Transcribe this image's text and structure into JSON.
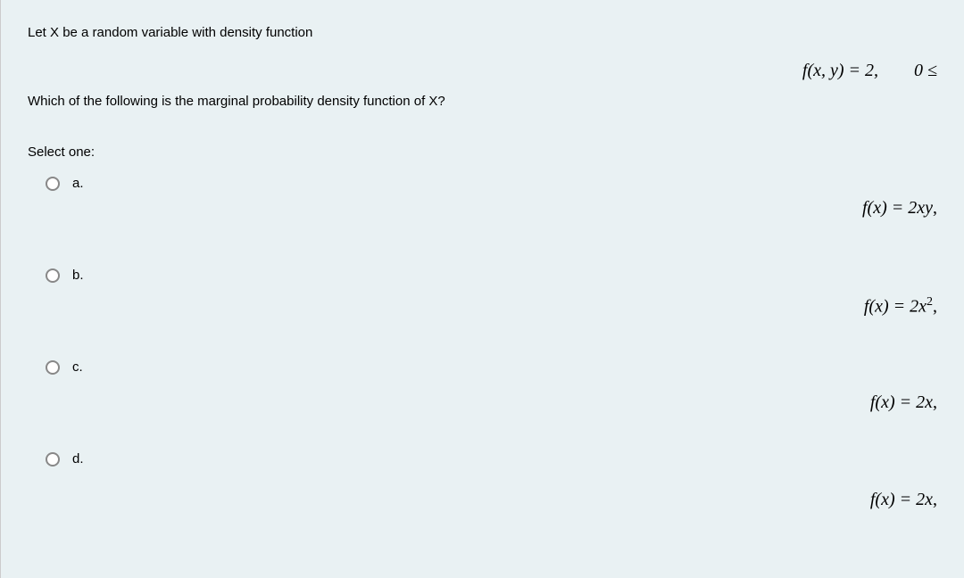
{
  "question": {
    "intro": "Let X be a random variable with density function",
    "formula_main": "f(x, y) = 2,  0 ≤",
    "subquestion": "Which of the following is the marginal probability density function of X?",
    "select_label": "Select one:"
  },
  "options": {
    "a": {
      "label": "a.",
      "formula_prefix": "f(x) = 2xy",
      "formula_suffix": ","
    },
    "b": {
      "label": "b.",
      "formula_prefix": "f(x) = 2x",
      "formula_sup": "2",
      "formula_suffix": ","
    },
    "c": {
      "label": "c.",
      "formula_prefix": "f(x) = 2x",
      "formula_suffix": ","
    },
    "d": {
      "label": "d.",
      "formula_prefix": "f(x) = 2x",
      "formula_suffix": ","
    }
  }
}
